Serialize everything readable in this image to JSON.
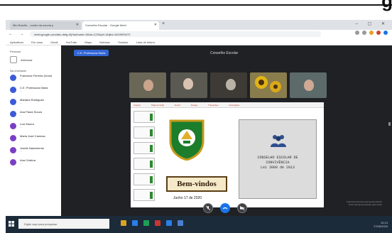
{
  "top_strip": {
    "glyph": "g"
  },
  "browser": {
    "tabs": [
      {
        "label": "Mtn Brazile... contre da escola p",
        "active": false
      },
      {
        "label": "Conselho Escolar - Google Meet",
        "active": true
      }
    ],
    "new_tab": "+",
    "window_controls": "– ▢ ✕",
    "nav_buttons": "← → ⟳",
    "url": "meet.google.com/abc-defg-hij?authuser=0&hs=122&pli=1&ijlm=1615993472",
    "bookmarks": [
      "Aplicativos",
      "Em casa",
      "Gmail",
      "YouTube",
      "Maps",
      "Notícias",
      "Tradutor",
      "Lista de leitura"
    ]
  },
  "sidebar": {
    "heading": "Pessoas",
    "row_label": "Adicionar",
    "section_label": "Na chamada",
    "participants": [
      {
        "name": "Francisca Ferreira (Você)",
        "color": "#3b5bd6"
      },
      {
        "name": "C.E. Professora Maria",
        "color": "#3b5bd6"
      },
      {
        "name": "Mariana Rodrigues",
        "color": "#3b5bd6"
      },
      {
        "name": "Ana Paula Souza",
        "color": "#3b5bd6"
      },
      {
        "name": "Luiz Moura",
        "color": "#7b3fc4"
      },
      {
        "name": "Maria José Cardoso",
        "color": "#7b3fc4"
      },
      {
        "name": "Josefa Nascimento",
        "color": "#7b3fc4"
      },
      {
        "name": "Ana Cristina",
        "color": "#7b3fc4"
      }
    ]
  },
  "meeting": {
    "presenting_pill": "C.E. Professora Maria",
    "title": "Conselho Escolar",
    "slide": {
      "ribbon": [
        "Arquivo",
        "Página Inicial",
        "Inserir",
        "Design",
        "Transições",
        "Animações"
      ],
      "banner": "Bem-vindos",
      "date": "Junho 17 de 2020",
      "card_lines": [
        "CONSELHO ESCOLAR DE",
        "CONVIVÊNCIA",
        "Lei 3000 de 2013"
      ]
    },
    "controls": [
      "mic-off",
      "end-call",
      "camera-off"
    ],
    "caption": [
      "Francisca Ferreira está apresentando",
      "Você está apresentando para todos"
    ]
  },
  "taskbar": {
    "search_placeholder": "Digite aqui para pesquisar",
    "tray_time": "10:13",
    "tray_date": "17/06/2020",
    "apps": [
      "#d9a521",
      "#2b7de9",
      "#1f9f54",
      "#c7372f",
      "#2b7de9",
      "#4a7fd0"
    ]
  }
}
